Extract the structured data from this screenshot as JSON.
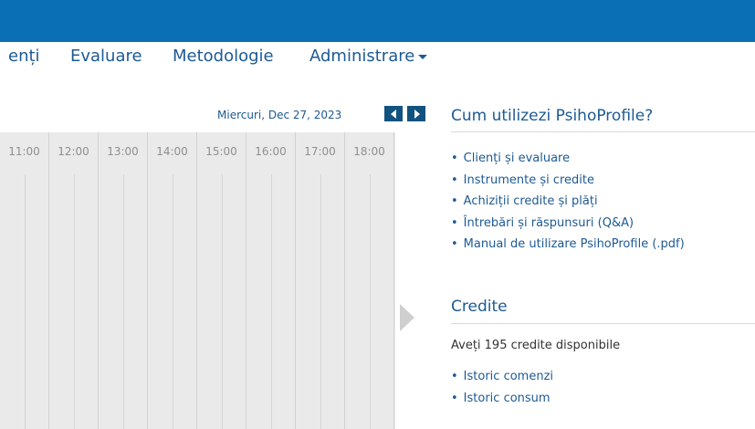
{
  "nav": {
    "items": [
      "enți",
      "Evaluare",
      "Metodologie",
      "Administrare"
    ]
  },
  "calendar": {
    "date": "Miercuri, Dec 27, 2023",
    "hours": [
      "11:00",
      "12:00",
      "13:00",
      "14:00",
      "15:00",
      "16:00",
      "17:00",
      "18:00"
    ]
  },
  "help": {
    "title": "Cum utilizezi PsihoProfile?",
    "links": [
      "Clienți și evaluare",
      "Instrumente și credite",
      "Achiziții credite și plăți",
      "Întrebări și răspunsuri (Q&A)",
      "Manual de utilizare PsihoProfile (.pdf)"
    ]
  },
  "credits": {
    "title": "Credite",
    "text": "Aveți 195 credite disponibile",
    "links": [
      "Istoric comenzi",
      "Istoric consum"
    ]
  },
  "colors": {
    "topbar": "#0b6fb5",
    "link": "#1d5a93",
    "nav_button": "#12527f"
  }
}
